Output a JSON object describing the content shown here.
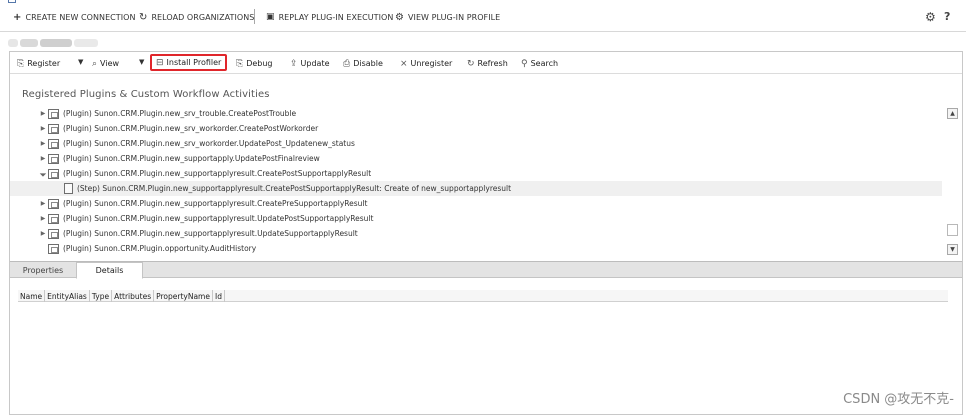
{
  "top_toolbar": {
    "create_connection": "CREATE NEW CONNECTION",
    "reload_orgs": "RELOAD ORGANIZATIONS",
    "replay": "REPLAY PLUG-IN EXECUTION",
    "view_profile": "VIEW PLUG-IN PROFILE"
  },
  "plugin_toolbar": {
    "register": "Register",
    "view": "View",
    "install_profiler": "Install Profiler",
    "debug": "Debug",
    "update": "Update",
    "disable": "Disable",
    "unregister": "Unregister",
    "refresh": "Refresh",
    "search": "Search"
  },
  "section_title": "Registered Plugins & Custom Workflow Activities",
  "tree": [
    {
      "text": "(Plugin) Sunon.CRM.Plugin.new_srv_trouble.CreatePostTrouble",
      "expanded": false,
      "level": 0
    },
    {
      "text": "(Plugin) Sunon.CRM.Plugin.new_srv_workorder.CreatePostWorkorder",
      "expanded": false,
      "level": 0
    },
    {
      "text": "(Plugin) Sunon.CRM.Plugin.new_srv_workorder.UpdatePost_Updatenew_status",
      "expanded": false,
      "level": 0
    },
    {
      "text": "(Plugin) Sunon.CRM.Plugin.new_supportapply.UpdatePostFinalreview",
      "expanded": false,
      "level": 0
    },
    {
      "text": "(Plugin) Sunon.CRM.Plugin.new_supportapplyresult.CreatePostSupportapplyResult",
      "expanded": true,
      "level": 0
    },
    {
      "text": "(Step) Sunon.CRM.Plugin.new_supportapplyresult.CreatePostSupportapplyResult: Create of new_supportapplyresult",
      "expanded": null,
      "level": 1
    },
    {
      "text": "(Plugin) Sunon.CRM.Plugin.new_supportapplyresult.CreatePreSupportapplyResult",
      "expanded": false,
      "level": 0
    },
    {
      "text": "(Plugin) Sunon.CRM.Plugin.new_supportapplyresult.UpdatePostSupportapplyResult",
      "expanded": false,
      "level": 0
    },
    {
      "text": "(Plugin) Sunon.CRM.Plugin.new_supportapplyresult.UpdateSupportapplyResult",
      "expanded": false,
      "level": 0
    },
    {
      "text": "(Plugin) Sunon.CRM.Plugin.opportunity.AuditHistory",
      "expanded": null,
      "level": 0
    }
  ],
  "tabs": {
    "properties": "Properties",
    "details": "Details"
  },
  "details_columns": [
    "Name",
    "EntityAlias",
    "Type",
    "Attributes",
    "PropertyName",
    "Id"
  ],
  "watermark": "CSDN @攻无不克-"
}
